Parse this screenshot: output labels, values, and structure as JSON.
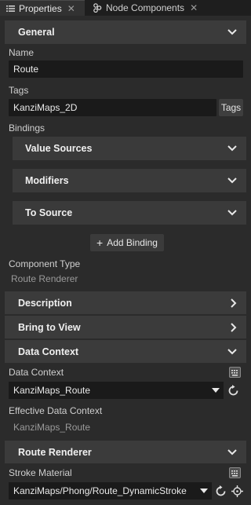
{
  "tabs": [
    {
      "label": "Properties",
      "active": true,
      "icon": "list-icon"
    },
    {
      "label": "Node Components",
      "active": false,
      "icon": "component-icon"
    }
  ],
  "general": {
    "title": "General",
    "name_label": "Name",
    "name_value": "Route",
    "tags_label": "Tags",
    "tags_value": "KanziMaps_2D",
    "tags_button": "Tags",
    "bindings_label": "Bindings",
    "value_sources": "Value Sources",
    "modifiers": "Modifiers",
    "to_source": "To Source",
    "add_binding": "Add Binding",
    "component_type_label": "Component Type",
    "component_type_value": "Route Renderer"
  },
  "sections": {
    "description": "Description",
    "bring_to_view": "Bring to View",
    "data_context": "Data Context",
    "route_renderer": "Route Renderer"
  },
  "data_context": {
    "label": "Data Context",
    "value": "KanziMaps_Route",
    "effective_label": "Effective Data Context",
    "effective_value": "KanziMaps_Route"
  },
  "route_renderer": {
    "stroke_label": "Stroke Material",
    "stroke_value": "KanziMaps/Phong/Route_DynamicStroke"
  },
  "colors": {
    "background": "#2b2b2b",
    "section": "#3b3b3b",
    "field": "#1a1a1a",
    "text": "#d6d6d6"
  }
}
